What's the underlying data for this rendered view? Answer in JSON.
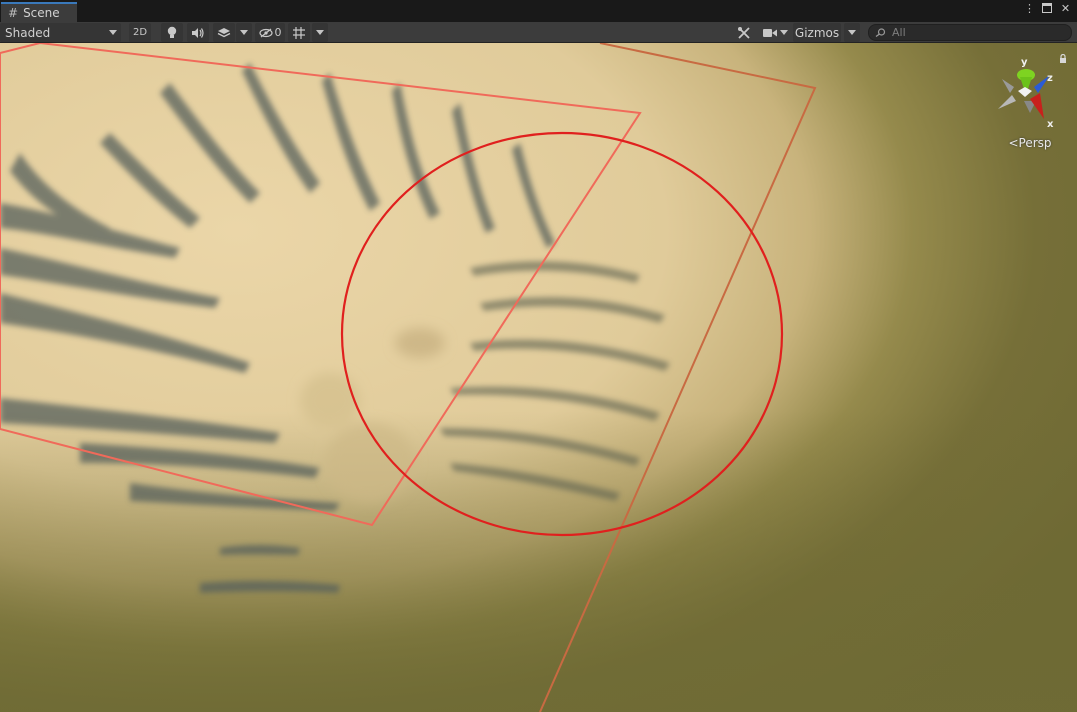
{
  "window": {
    "tab_label": "Scene",
    "tab_icon": "grid-hash-icon"
  },
  "toolbar": {
    "draw_mode": "Shaded",
    "btn_2d": "2D",
    "hidden_count": "0",
    "gizmos_label": "Gizmos",
    "search_placeholder": "All"
  },
  "scene_gizmo": {
    "projection_label": "Persp",
    "axes": {
      "x": "x",
      "y": "y",
      "z": "z"
    },
    "axis_colors": {
      "x": "#c8201c",
      "y": "#7ed321",
      "z": "#2a5bd7"
    }
  },
  "viewport": {
    "colors": {
      "terrain_sand": "#e4cfa0",
      "terrain_shadow": "#4f5856",
      "ground_olive": "#706d36",
      "brush_circle": "#e0201e",
      "selection_box_inner": "#f06a5a",
      "selection_box_outer": "#c86a42"
    }
  }
}
